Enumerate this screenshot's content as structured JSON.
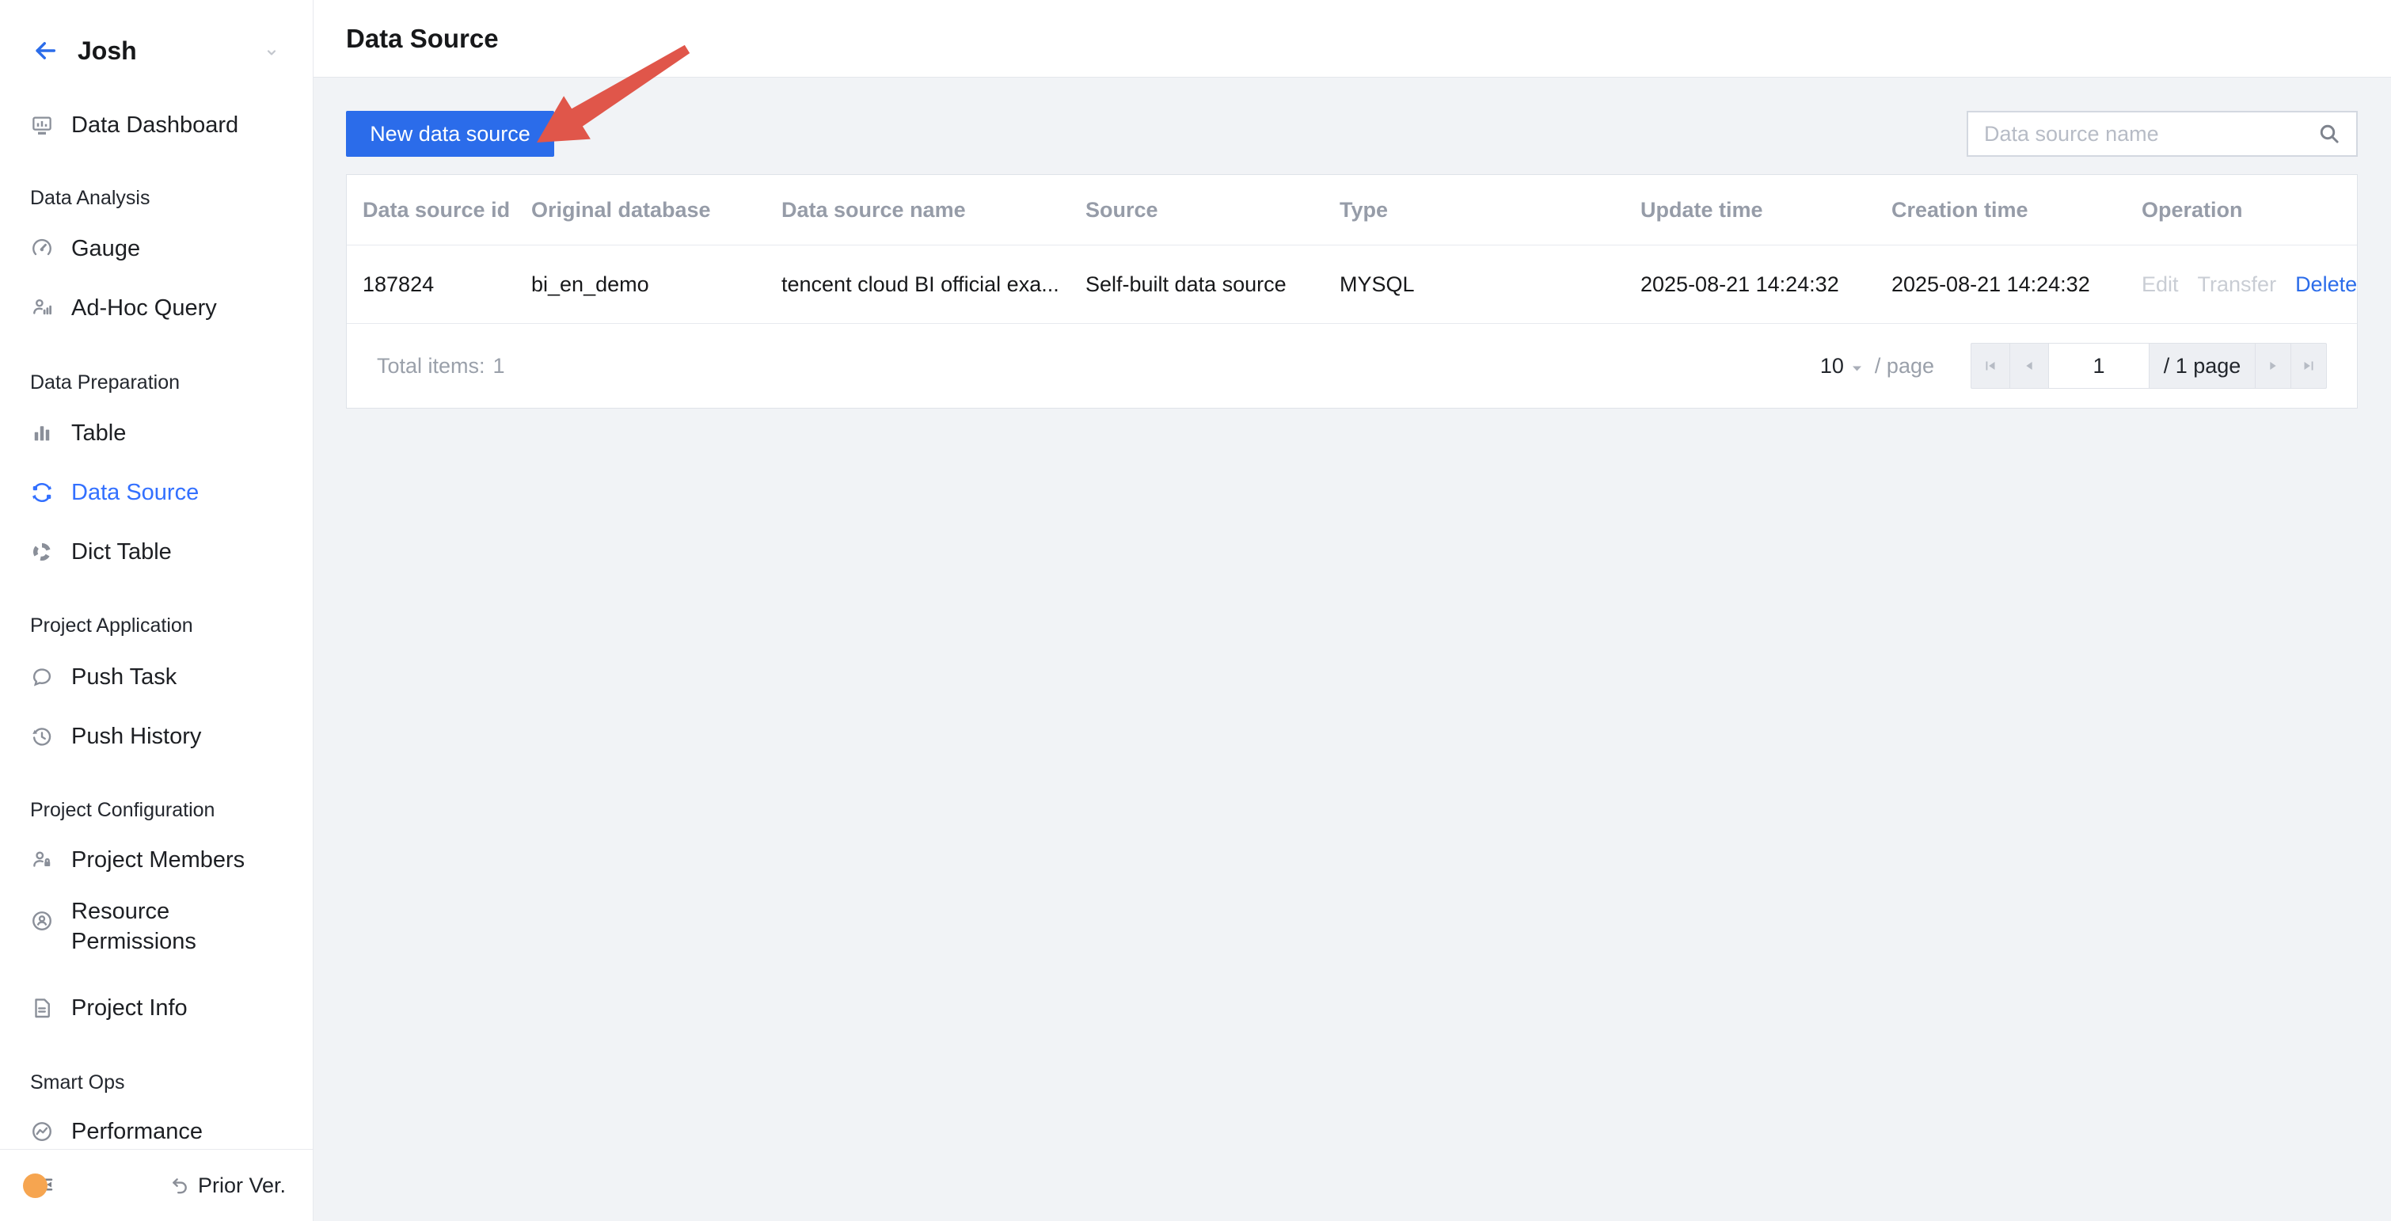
{
  "sidebar": {
    "workspace_name": "Josh",
    "items": [
      {
        "type": "item",
        "label": "Data Dashboard",
        "icon": "dashboard-icon"
      },
      {
        "type": "section",
        "label": "Data Analysis"
      },
      {
        "type": "item",
        "label": "Gauge",
        "icon": "gauge-icon"
      },
      {
        "type": "item",
        "label": "Ad-Hoc Query",
        "icon": "adhoc-query-icon"
      },
      {
        "type": "section",
        "label": "Data Preparation"
      },
      {
        "type": "item",
        "label": "Table",
        "icon": "table-icon"
      },
      {
        "type": "item",
        "label": "Data Source",
        "icon": "data-source-icon",
        "active": true
      },
      {
        "type": "item",
        "label": "Dict Table",
        "icon": "dict-table-icon"
      },
      {
        "type": "section",
        "label": "Project Application"
      },
      {
        "type": "item",
        "label": "Push Task",
        "icon": "push-task-icon"
      },
      {
        "type": "item",
        "label": "Push History",
        "icon": "push-history-icon"
      },
      {
        "type": "section",
        "label": "Project Configuration"
      },
      {
        "type": "item",
        "label": "Project Members",
        "icon": "project-members-icon"
      },
      {
        "type": "item",
        "label": "Resource Permissions",
        "icon": "resource-permissions-icon"
      },
      {
        "type": "item",
        "label": "Project Info",
        "icon": "project-info-icon"
      },
      {
        "type": "section",
        "label": "Smart Ops"
      },
      {
        "type": "item",
        "label": "Performance",
        "icon": "performance-icon"
      }
    ],
    "footer": {
      "prior_version_label": "Prior Ver."
    }
  },
  "page": {
    "title": "Data Source"
  },
  "toolbar": {
    "new_data_source_label": "New data source",
    "search_placeholder": "Data source name"
  },
  "table": {
    "columns": [
      "Data source id",
      "Original database",
      "Data source name",
      "Source",
      "Type",
      "Update time",
      "Creation time",
      "Operation"
    ],
    "rows": [
      {
        "id": "187824",
        "original_database": "bi_en_demo",
        "name": "tencent cloud BI official exa...",
        "source": "Self-built data source",
        "type": "MYSQL",
        "update_time": "2025-08-21 14:24:32",
        "creation_time": "2025-08-21 14:24:32"
      }
    ],
    "row_actions": {
      "edit": "Edit",
      "transfer": "Transfer",
      "delete": "Delete"
    }
  },
  "pagination": {
    "total_label": "Total items:",
    "total_count": "1",
    "page_size": "10",
    "per_page_label": "/ page",
    "current_page": "1",
    "page_count_label": "/ 1 page"
  },
  "colors": {
    "accent": "#2b6cea",
    "sidebar_active": "#3370ff",
    "arrow_annotation": "#e0564a",
    "content_background": "#f1f3f6",
    "orange_badge": "#f6a550"
  }
}
